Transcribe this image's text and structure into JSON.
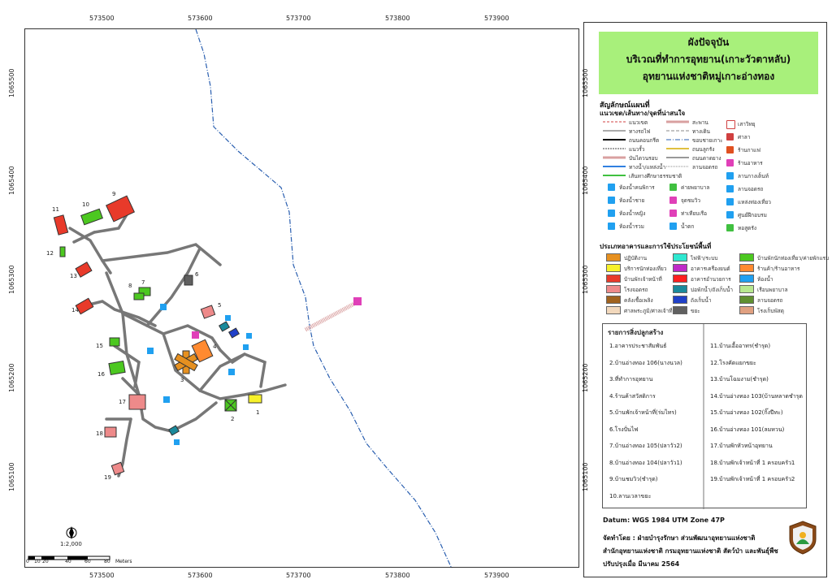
{
  "grid": {
    "x_labels": [
      "573500",
      "573600",
      "573700",
      "573800",
      "573900"
    ],
    "y_labels": [
      "1065500",
      "1065400",
      "1065300",
      "1065200",
      "1065100"
    ]
  },
  "title": {
    "line1": "ผังปัจจุบัน",
    "line2": "บริเวณที่ทำการอุทยาน(เกาะวัวตาหลับ)",
    "line3": "อุทยานแห่งชาติหมู่เกาะอ่างทอง"
  },
  "legend": {
    "heading": "สัญลักษณ์แผนที่",
    "sub_heading": "แนวเขต/เส้นทาง/จุดที่น่าสนใจ",
    "lines_col1": [
      "แนวเขต",
      "ทางรถไฟ",
      "ถนนคอนกรีต",
      "แนวรั้ว",
      "บันไดวนรอบ",
      "ทางน้ำ/แหล่งน้ำ",
      "เส้นทางศึกษาธรรมชาติ"
    ],
    "lines_col2": [
      "สะพาน",
      "ทางเดิน",
      "ขอบชายเกาะ",
      "ถนนลูกรัง",
      "ถนนดาดยาง",
      "ลานจอดรถ"
    ],
    "points_col3": [
      "เสาวิทยุ",
      "ศาลา",
      "ร้านกาแฟ",
      "ร้านอาหาร",
      "ลานกางเต็นท์",
      "ลานจอดรถ",
      "แหล่งท่องเที่ยว",
      "ศูนย์ฝึกอบรม",
      "หอสูตรัง"
    ],
    "icons_row": [
      {
        "a": "ห้องน้ำคนพิการ",
        "b": "ค่ายพยาบาล"
      },
      {
        "a": "ห้องน้ำชาย",
        "b": "จุดชมวิว"
      },
      {
        "a": "ห้องน้ำหญิง",
        "b": "ท่าเทียบเรือ"
      },
      {
        "a": "ห้องน้ำรวม",
        "b": "น้ำตก"
      }
    ],
    "landuse_heading": "ประเภทอาคารและการใช้ประโยชน์พื้นที่",
    "landuse": [
      {
        "label": "ปฏิบัติงาน",
        "color": "#e69020"
      },
      {
        "label": "บริการนักท่องเที่ยว",
        "color": "#f7f12a"
      },
      {
        "label": "บ้านพักเจ้าหน้าที่",
        "color": "#e83a2a"
      },
      {
        "label": "โรงจอดรถ",
        "color": "#ee8a8a"
      },
      {
        "label": "คลังเชื้อเพลิง",
        "color": "#a0621e"
      },
      {
        "label": "ศาลพระภูมิ/ศาลเจ้าที่",
        "color": "#f2d8bc"
      },
      {
        "label": "ไฟฟ้า/ระบบ",
        "color": "#2fe8d0"
      },
      {
        "label": "อาคารเครื่องยนต์",
        "color": "#c02ac8"
      },
      {
        "label": "อาคารอำนวยการ",
        "color": "#ff2020"
      },
      {
        "label": "บ่อพักน้ำ/ถังเก็บน้ำ",
        "color": "#1a8a9c"
      },
      {
        "label": "ถังเก็บน้ำ",
        "color": "#2040c8"
      },
      {
        "label": "ขยะ",
        "color": "#606060"
      },
      {
        "label": "บ้านพักนักท่องเที่ยว/ค่ายพักแรม",
        "color": "#4cc820"
      },
      {
        "label": "ร้านค้า/ร้านอาหาร",
        "color": "#ff8a30"
      },
      {
        "label": "ห้องน้ำ",
        "color": "#20a0f0"
      },
      {
        "label": "เรือนพยาบาล",
        "color": "#b8e890"
      },
      {
        "label": "ลานจอดรถ",
        "color": "#609030"
      },
      {
        "label": "โรงเก็บพัสดุ",
        "color": "#e0a080"
      }
    ]
  },
  "buildings": {
    "heading": "รายการสิ่งปลูกสร้าง",
    "col1": [
      "1.อาคารประชาสัมพันธ์",
      "2.บ้านอ่างทอง 106(นางนวล)",
      "3.ที่ทำการอุทยาน",
      "4.ร้านค้าสวัสดิการ",
      "5.บ้านพักเจ้าหน้าที่(ร่มไทร)",
      "6.โรงปั่นไฟ",
      "7.บ้านอ่างทอง 105(ปลาวัว2)",
      "8.บ้านอ่างทอง 104(ปลาวัว1)",
      "9.บ้านชมวิว(ชำรุด)",
      "10.ลานเวลาขยะ"
    ],
    "col2": [
      "11.บ้านเอื้ออาทร(ชำรุด)",
      "12.โรงคัดแยกขยะ",
      "13.บ้านโฉมงาม(ชำรุด)",
      "14.บ้านอ่างทอง 103(บ้านหลาดชำรุด",
      "15.บ้านอ่างทอง 102(กิ๊งปีทะ)",
      "16.บ้านอ่างทอง 101(ลมหวน)",
      "17.บ้านพักหัวหน้าอุทยาน",
      "18.บ้านพักเจ้าหน้าที่ 1 ครอบครัว1",
      "19.บ้านพักเจ้าหน้าที่ 1 ครอบครัว2"
    ]
  },
  "map_labels": [
    "1",
    "2",
    "3",
    "4",
    "5",
    "6",
    "7",
    "8",
    "9",
    "10",
    "11",
    "12",
    "13",
    "14",
    "15",
    "16",
    "17",
    "18",
    "19"
  ],
  "scale": {
    "ratio": "1:2,000",
    "ticks": [
      "0",
      "10",
      "20",
      "40",
      "60",
      "80"
    ],
    "unit": "Meters"
  },
  "footer": {
    "datum_label": "Datum",
    "datum_value": ": WGS 1984 UTM Zone 47P",
    "made_by": "จัดทำโดย  : ฝ่ายบำรุงรักษา ส่วนพัฒนาอุทยานแห่งชาติ",
    "office": "สำนักอุทยานแห่งชาติ  กรมอุทยานแห่งชาติ สัตว์ป่า และพันธุ์พืช",
    "updated": "ปรับปรุงเมื่อ มีนาคม 2564"
  }
}
